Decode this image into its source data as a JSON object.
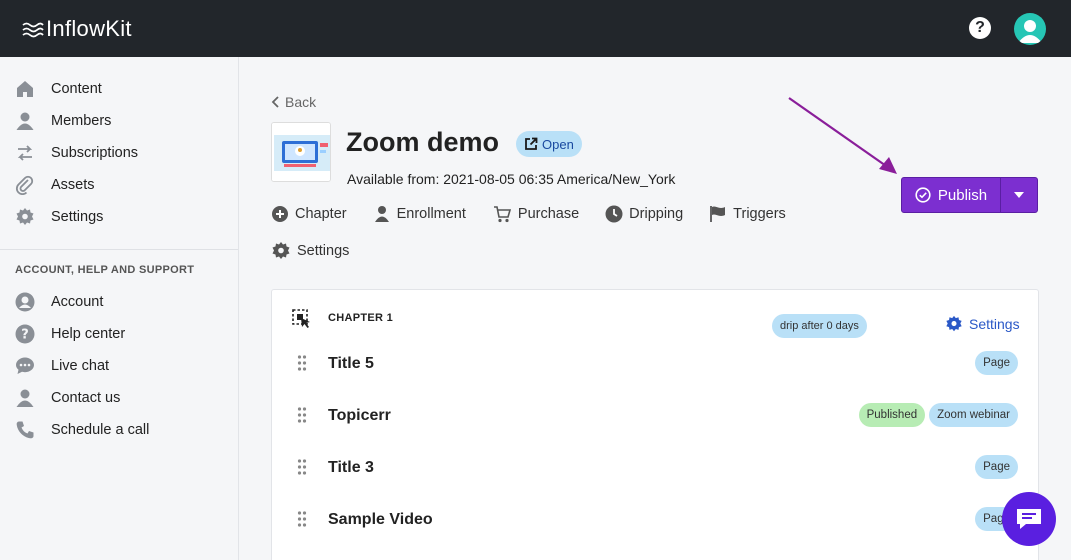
{
  "header": {
    "logo_text": "InflowKit",
    "help_icon": "?"
  },
  "sidebar": {
    "items": [
      {
        "label": "Content",
        "icon": "home-icon"
      },
      {
        "label": "Members",
        "icon": "person-icon"
      },
      {
        "label": "Subscriptions",
        "icon": "swap-arrows-icon"
      },
      {
        "label": "Assets",
        "icon": "paperclip-icon"
      },
      {
        "label": "Settings",
        "icon": "gear-icon"
      }
    ],
    "section_heading": "ACCOUNT, HELP AND SUPPORT",
    "support_items": [
      {
        "label": "Account",
        "icon": "account-circle-icon"
      },
      {
        "label": "Help center",
        "icon": "question-circle-icon"
      },
      {
        "label": "Live chat",
        "icon": "chat-dots-icon"
      },
      {
        "label": "Contact us",
        "icon": "person-icon"
      },
      {
        "label": "Schedule a call",
        "icon": "phone-icon"
      }
    ]
  },
  "page": {
    "back_label": "Back",
    "title": "Zoom demo",
    "open_badge": "Open",
    "available_from": "Available from: 2021-08-05 06:35 America/New_York",
    "publish_label": "Publish",
    "tabs": [
      {
        "label": "Chapter",
        "icon": "plus-circle-icon"
      },
      {
        "label": "Enrollment",
        "icon": "person-icon"
      },
      {
        "label": "Purchase",
        "icon": "cart-icon"
      },
      {
        "label": "Dripping",
        "icon": "clock-icon"
      },
      {
        "label": "Triggers",
        "icon": "flag-icon"
      },
      {
        "label": "Settings",
        "icon": "gear-icon"
      }
    ]
  },
  "chapter": {
    "label": "CHAPTER 1",
    "drip_badge": "drip after 0 days",
    "settings_label": "Settings",
    "rows": [
      {
        "title": "Title 5",
        "badges": [
          "Page"
        ]
      },
      {
        "title": "Topicerr",
        "badges": [
          "Published",
          "Zoom webinar"
        ]
      },
      {
        "title": "Title 3",
        "badges": [
          "Page"
        ]
      },
      {
        "title": "Sample Video",
        "badges": [
          "Page"
        ]
      }
    ]
  },
  "colors": {
    "topbar": "#22262b",
    "publish": "#7c2fd0",
    "accent_link": "#2a58c7",
    "badge_blue": "#b9e0f7",
    "badge_green": "#b7ecb4",
    "chat": "#5a1fe0"
  }
}
